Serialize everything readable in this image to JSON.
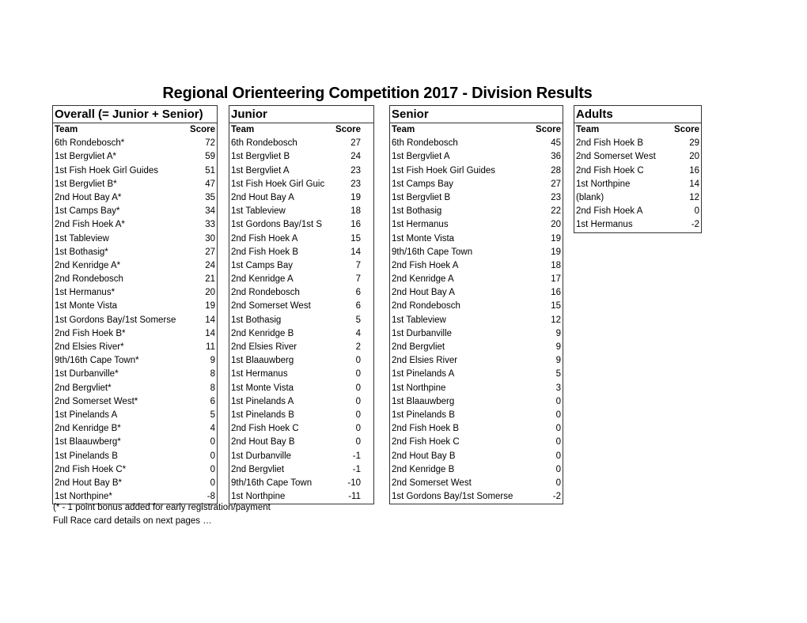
{
  "title": "Regional Orienteering Competition 2017 - Division Results",
  "column_headers": {
    "team": "Team",
    "score": "Score"
  },
  "tables": {
    "overall": {
      "heading": "Overall (= Junior + Senior)",
      "rows": [
        {
          "team": "6th Rondebosch*",
          "score": "72"
        },
        {
          "team": "1st Bergvliet A*",
          "score": "59"
        },
        {
          "team": "1st Fish Hoek Girl Guides",
          "score": "51"
        },
        {
          "team": "1st Bergvliet B*",
          "score": "47"
        },
        {
          "team": "2nd Hout Bay A*",
          "score": "35"
        },
        {
          "team": "1st Camps Bay*",
          "score": "34"
        },
        {
          "team": "2nd Fish Hoek A*",
          "score": "33"
        },
        {
          "team": "1st Tableview",
          "score": "30"
        },
        {
          "team": "1st Bothasig*",
          "score": "27"
        },
        {
          "team": "2nd Kenridge A*",
          "score": "24"
        },
        {
          "team": "2nd Rondebosch",
          "score": "21"
        },
        {
          "team": "1st Hermanus*",
          "score": "20"
        },
        {
          "team": "1st Monte Vista",
          "score": "19"
        },
        {
          "team": "1st Gordons Bay/1st Somerse",
          "score": "14"
        },
        {
          "team": "2nd Fish Hoek B*",
          "score": "14"
        },
        {
          "team": "2nd Elsies River*",
          "score": "11"
        },
        {
          "team": "9th/16th Cape Town*",
          "score": "9"
        },
        {
          "team": "1st Durbanville*",
          "score": "8"
        },
        {
          "team": "2nd Bergvliet*",
          "score": "8"
        },
        {
          "team": "2nd Somerset West*",
          "score": "6"
        },
        {
          "team": "1st Pinelands A",
          "score": "5"
        },
        {
          "team": "2nd Kenridge B*",
          "score": "4"
        },
        {
          "team": "1st Blaauwberg*",
          "score": "0"
        },
        {
          "team": "1st Pinelands B",
          "score": "0"
        },
        {
          "team": "2nd Fish Hoek C*",
          "score": "0"
        },
        {
          "team": "2nd Hout Bay B*",
          "score": "0"
        },
        {
          "team": "1st Northpine*",
          "score": "-8"
        }
      ]
    },
    "junior": {
      "heading": "Junior",
      "rows": [
        {
          "team": "6th Rondebosch",
          "score": "27"
        },
        {
          "team": "1st Bergvliet B",
          "score": "24"
        },
        {
          "team": "1st Bergvliet A",
          "score": "23"
        },
        {
          "team": "1st Fish Hoek Girl Guic",
          "score": "23"
        },
        {
          "team": "2nd Hout Bay A",
          "score": "19"
        },
        {
          "team": "1st Tableview",
          "score": "18"
        },
        {
          "team": "1st Gordons Bay/1st S",
          "score": "16"
        },
        {
          "team": "2nd Fish Hoek A",
          "score": "15"
        },
        {
          "team": "2nd Fish Hoek B",
          "score": "14"
        },
        {
          "team": "1st Camps Bay",
          "score": "7"
        },
        {
          "team": "2nd Kenridge A",
          "score": "7"
        },
        {
          "team": "2nd Rondebosch",
          "score": "6"
        },
        {
          "team": "2nd Somerset West",
          "score": "6"
        },
        {
          "team": "1st Bothasig",
          "score": "5"
        },
        {
          "team": "2nd Kenridge B",
          "score": "4"
        },
        {
          "team": "2nd Elsies River",
          "score": "2"
        },
        {
          "team": "1st Blaauwberg",
          "score": "0"
        },
        {
          "team": "1st Hermanus",
          "score": "0"
        },
        {
          "team": "1st Monte Vista",
          "score": "0"
        },
        {
          "team": "1st Pinelands A",
          "score": "0"
        },
        {
          "team": "1st Pinelands B",
          "score": "0"
        },
        {
          "team": "2nd Fish Hoek C",
          "score": "0"
        },
        {
          "team": "2nd Hout Bay B",
          "score": "0"
        },
        {
          "team": "1st Durbanville",
          "score": "-1"
        },
        {
          "team": "2nd Bergvliet",
          "score": "-1"
        },
        {
          "team": "9th/16th Cape Town",
          "score": "-10"
        },
        {
          "team": "1st Northpine",
          "score": "-11"
        }
      ]
    },
    "senior": {
      "heading": "Senior",
      "rows": [
        {
          "team": "6th Rondebosch",
          "score": "45"
        },
        {
          "team": "1st Bergvliet A",
          "score": "36"
        },
        {
          "team": "1st Fish Hoek Girl Guides",
          "score": "28"
        },
        {
          "team": "1st Camps Bay",
          "score": "27"
        },
        {
          "team": "1st Bergvliet B",
          "score": "23"
        },
        {
          "team": "1st Bothasig",
          "score": "22"
        },
        {
          "team": "1st Hermanus",
          "score": "20"
        },
        {
          "team": "1st Monte Vista",
          "score": "19"
        },
        {
          "team": "9th/16th Cape Town",
          "score": "19"
        },
        {
          "team": "2nd Fish Hoek A",
          "score": "18"
        },
        {
          "team": "2nd Kenridge A",
          "score": "17"
        },
        {
          "team": "2nd Hout Bay A",
          "score": "16"
        },
        {
          "team": "2nd Rondebosch",
          "score": "15"
        },
        {
          "team": "1st Tableview",
          "score": "12"
        },
        {
          "team": "1st Durbanville",
          "score": "9"
        },
        {
          "team": "2nd Bergvliet",
          "score": "9"
        },
        {
          "team": "2nd Elsies River",
          "score": "9"
        },
        {
          "team": "1st Pinelands A",
          "score": "5"
        },
        {
          "team": "1st Northpine",
          "score": "3"
        },
        {
          "team": "1st Blaauwberg",
          "score": "0"
        },
        {
          "team": "1st Pinelands B",
          "score": "0"
        },
        {
          "team": "2nd Fish Hoek B",
          "score": "0"
        },
        {
          "team": "2nd Fish Hoek C",
          "score": "0"
        },
        {
          "team": "2nd Hout Bay B",
          "score": "0"
        },
        {
          "team": "2nd Kenridge B",
          "score": "0"
        },
        {
          "team": "2nd Somerset West",
          "score": "0"
        },
        {
          "team": "1st Gordons Bay/1st Somerse",
          "score": "-2"
        }
      ]
    },
    "adults": {
      "heading": "Adults",
      "rows": [
        {
          "team": "2nd Fish Hoek B",
          "score": "29"
        },
        {
          "team": "2nd Somerset West",
          "score": "20"
        },
        {
          "team": "2nd Fish Hoek C",
          "score": "16"
        },
        {
          "team": "1st Northpine",
          "score": "14"
        },
        {
          "team": "(blank)",
          "score": "12"
        },
        {
          "team": "2nd Fish Hoek A",
          "score": "0"
        },
        {
          "team": "1st Hermanus",
          "score": "-2"
        }
      ]
    }
  },
  "notes": [
    "(* - 1 point bonus added for early registration/payment",
    "Full Race card details on next  pages …"
  ]
}
